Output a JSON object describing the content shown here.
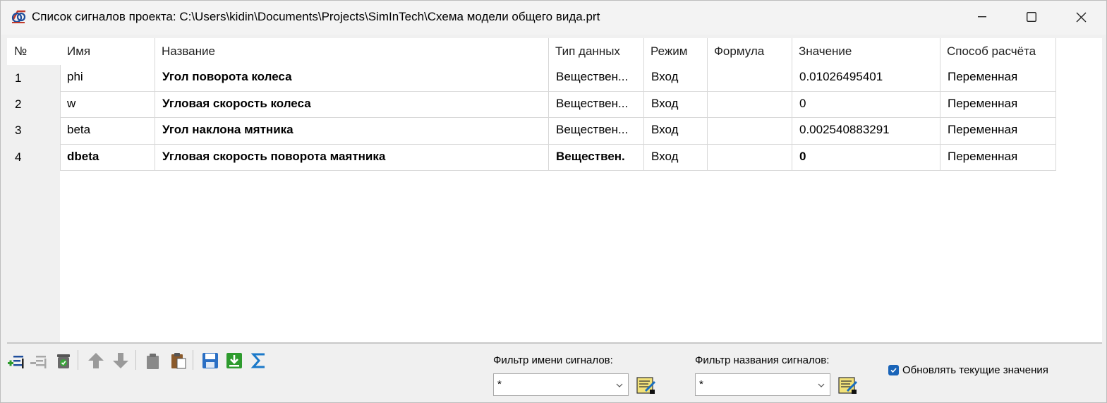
{
  "window": {
    "title": "Список сигналов проекта: C:\\Users\\kidin\\Documents\\Projects\\SimInTech\\Схема модели общего вида.prt"
  },
  "table": {
    "columns": [
      "№",
      "Имя",
      "Название",
      "Тип данных",
      "Режим",
      "Формула",
      "Значение",
      "Способ расчёта"
    ],
    "rows": [
      {
        "num": "1",
        "name": "phi",
        "title": "Угол поворота колеса",
        "type": "Веществен...",
        "mode": "Вход",
        "formula": "",
        "value": "0.01026495401",
        "method": "Переменная"
      },
      {
        "num": "2",
        "name": "w",
        "title": "Угловая скорость колеса",
        "type": "Веществен...",
        "mode": "Вход",
        "formula": "",
        "value": "0",
        "method": "Переменная"
      },
      {
        "num": "3",
        "name": "beta",
        "title": "Угол наклона мятника",
        "type": "Веществен...",
        "mode": "Вход",
        "formula": "",
        "value": "0.002540883291",
        "method": "Переменная"
      },
      {
        "num": "4",
        "name": "dbeta",
        "title": "Угловая скорость поворота маятника",
        "type": "Веществен.",
        "mode": "Вход",
        "formula": "",
        "value": "0",
        "method": "Переменная"
      }
    ]
  },
  "toolbar": {
    "icons": [
      "add-signal-icon",
      "remove-signal-icon",
      "delete-icon",
      "move-up-icon",
      "move-down-icon",
      "copy-icon",
      "paste-icon",
      "save-icon",
      "import-icon",
      "sum-icon"
    ]
  },
  "filters": {
    "name_label": "Фильтр имени сигналов:",
    "name_value": "*",
    "title_label": "Фильтр названия сигналов:",
    "title_value": "*"
  },
  "update_checkbox": {
    "label": "Обновлять текущие значения",
    "checked": true
  },
  "colors": {
    "accent": "#1a64b8",
    "grid_line": "#d8d8d8"
  }
}
